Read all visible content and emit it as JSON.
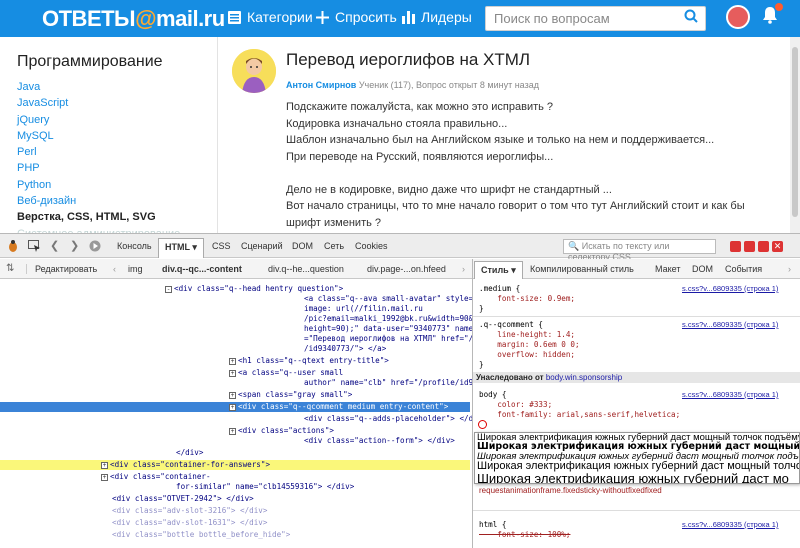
{
  "header": {
    "logo_text": "ОТВЕТЫ",
    "logo_at": "@",
    "logo_domain": "mail.ru",
    "nav": {
      "categories": "Категории",
      "ask": "Спросить",
      "leaders": "Лидеры"
    },
    "search_placeholder": "Поиск по вопросам"
  },
  "sidebar": {
    "title": "Программирование",
    "items": [
      "Java",
      "JavaScript",
      "jQuery",
      "MySQL",
      "Perl",
      "PHP",
      "Python",
      "Веб-дизайн",
      "Верстка, CSS, HTML, SVG",
      "Системное администрирование"
    ]
  },
  "question": {
    "title": "Перевод иероглифов на ХТМЛ",
    "author": "Антон Смирнов",
    "meta": "Ученик (117), Вопрос открыт 8 минут назад",
    "body": [
      "Подскажите пожалуйста, как можно это исправить ?",
      "Кодировка изначально стояла правильно...",
      "Шаблон изначально был на Английском языке и только на нем и поддерживается...",
      "При переводе на Русский, появляются иероглифы...",
      "",
      "Дело не в кодировке, видно даже что шрифт не стандартный ...",
      "Вот начало страницы, что то мне начало говорит о том что тут Английский стоит и как бы",
      "шрифт изменить ?"
    ]
  },
  "devtools": {
    "tabs": {
      "console": "Консоль",
      "html": "HTML",
      "css": "CSS",
      "script": "Сценарий",
      "dom": "DOM",
      "net": "Сеть",
      "cookies": "Cookies"
    },
    "search_placeholder": "Искать по тексту или селектору CSS",
    "edit_label": "Редактировать",
    "breadcrumbs": [
      "img",
      "div.q--qc...-content",
      "div.q--he...question",
      "div.page-...on.hfeed"
    ],
    "right_tabs": {
      "style": "Стиль",
      "computed": "Компилированный стиль",
      "layout": "Макет",
      "dom": "DOM",
      "events": "События"
    },
    "html_lines": [
      {
        "indent": 20,
        "toggle": "-",
        "text": "<div class=\"q--head hentry question\">",
        "style": ""
      },
      {
        "indent": 36,
        "toggle": "",
        "text": "<a class=\"q--ava small-avatar\" style=\"background-",
        "style": ""
      },
      {
        "indent": 36,
        "toggle": "",
        "text": "image: url(//filin.mail.ru",
        "style": ""
      },
      {
        "indent": 36,
        "toggle": "",
        "text": "/pic?email=malki_1992@bk.ru&width=90&",
        "style": ""
      },
      {
        "indent": 36,
        "toggle": "",
        "text": "height=90);\" data-user=\"9340773\" name=\"clb\" title",
        "style": ""
      },
      {
        "indent": 36,
        "toggle": "",
        "text": "=\"Перевод иероглифов на ХТМЛ\" href=\"/profile",
        "style": ""
      },
      {
        "indent": 36,
        "toggle": "",
        "text": "/id9340773/\"> </a>",
        "style": ""
      },
      {
        "indent": 28,
        "toggle": "+",
        "text": "<h1 class=\"q--qtext entry-title\">",
        "style": ""
      },
      {
        "indent": 28,
        "toggle": "+",
        "text": "<a class=\"q--user small",
        "style": ""
      },
      {
        "indent": 36,
        "toggle": "",
        "text": "author\" name=\"clb\" href=\"/profile/id9340773/\">",
        "style": ""
      },
      {
        "indent": 28,
        "toggle": "+",
        "text": "<span class=\"gray small\">",
        "style": ""
      },
      {
        "indent": 28,
        "toggle": "+",
        "text": "<div class=\"q--qcomment medium entry-content\">",
        "style": "sel"
      },
      {
        "indent": 36,
        "toggle": "",
        "text": "<div class=\"q--adds-placeholder\"> </div>",
        "style": ""
      },
      {
        "indent": 28,
        "toggle": "+",
        "text": "<div class=\"actions\">",
        "style": ""
      },
      {
        "indent": 36,
        "toggle": "",
        "text": "<div class=\"action--form\"> </div>",
        "style": ""
      },
      {
        "indent": 20,
        "toggle": "",
        "text": "</div>",
        "style": ""
      },
      {
        "indent": 12,
        "toggle": "+",
        "text": "<div class=\"container-for-answers\">",
        "style": "yel"
      },
      {
        "indent": 12,
        "toggle": "+",
        "text": "<div class=\"container-",
        "style": ""
      },
      {
        "indent": 20,
        "toggle": "",
        "text": "for-similar\" name=\"clb14559316\"> </div>",
        "style": ""
      },
      {
        "indent": 12,
        "toggle": "",
        "text": "<div class=\"OTVET-2942\"> </div>",
        "style": ""
      },
      {
        "indent": 12,
        "toggle": "",
        "text": "<div class=\"adv-slot-3216\"> </div>",
        "style": "faded"
      },
      {
        "indent": 12,
        "toggle": "",
        "text": "<div class=\"adv-slot-1631\"> </div>",
        "style": "faded"
      },
      {
        "indent": 12,
        "toggle": "",
        "text": "<div class=\"bottle bottle_before_hide\">",
        "style": "faded"
      }
    ],
    "css_rules": [
      {
        "lines": [
          ".medium {",
          "    font-size: 0.9em;",
          "}"
        ],
        "source": "s.css?v...6809335 (строка 1)"
      },
      {
        "lines": [
          ".q--qcomment {",
          "    line-height: 1.4;",
          "    margin: 0.6em 0 0;",
          "    overflow: hidden;",
          "}"
        ],
        "source": "s.css?v...6809335 (строка 1)"
      }
    ],
    "inherited_label": "Унаследовано от",
    "inherited_from": "body.win.sponsorship",
    "body_rule": {
      "lines": [
        "body {",
        "    color: #333;",
        "    font-family: arial,sans-serif,helvetica;"
      ],
      "source": "s.css?v...6809335 (строка 1)"
    },
    "raf_text": "requestanimationframe.fixedsticky-withoutfixedfixed",
    "html_rule": {
      "lines": [
        "html {",
        "    font-size: 100%;"
      ],
      "source": "s.css?v...6809335 (строка 1)"
    },
    "font_preview": [
      "Широкая электрификация южных губерний даст мощный толчок подъёму сел",
      "Широкая электрификация южных губерний даст мощный толчок подъём",
      "Широкая электрификация южных губерний даст мощный толчок подъёму сельс",
      "Широкая электрификация южных губерний даст мощный толчок подъё",
      "Широкая электрификация южных губерний даст мо"
    ]
  }
}
